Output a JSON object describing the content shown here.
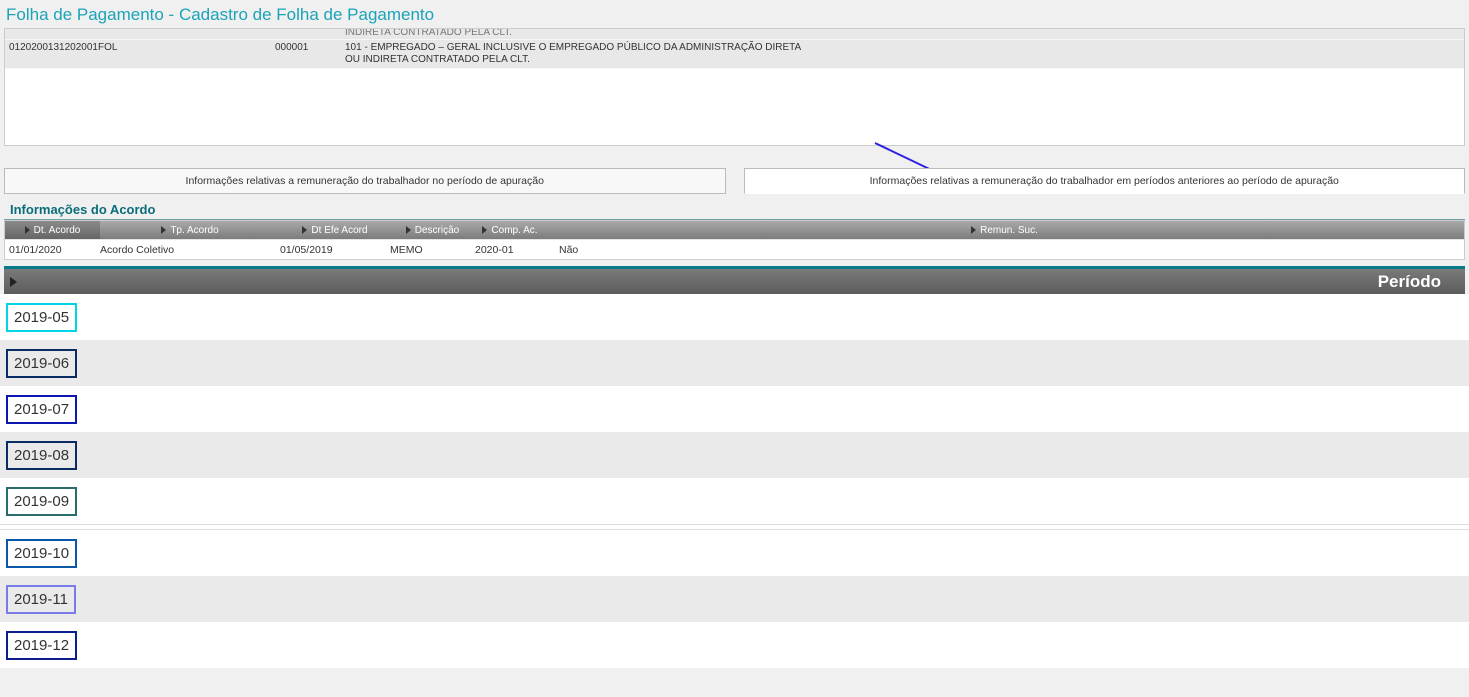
{
  "page_title": "Folha de Pagamento - Cadastro de Folha de Pagamento",
  "upper_grid": {
    "truncated_desc": "INDIRETA CONTRATADO PELA CLT.",
    "row": {
      "col1": "0120200131202001FOL",
      "col2": "000001",
      "col3": "101 - EMPREGADO – GERAL INCLUSIVE O EMPREGADO PÚBLICO DA ADMINISTRAÇÃO DIRETA OU INDIRETA CONTRATADO PELA CLT."
    }
  },
  "tabs": {
    "left": "Informações relativas a remuneração do trabalhador no período de apuração",
    "right": "Informações relativas a remuneração do trabalhador em períodos anteriores ao período de apuração"
  },
  "section_title": "Informações do Acordo",
  "acordo_headers": {
    "c1": "Dt. Acordo",
    "c2": "Tp. Acordo",
    "c3": "Dt Efe Acord",
    "c4": "Descrição",
    "c5": "Comp. Ac.",
    "c6": "Remun. Suc."
  },
  "acordo_row": {
    "c1": "01/01/2020",
    "c2": "Acordo Coletivo",
    "c3": "01/05/2019",
    "c4": "MEMO",
    "c5": "2020-01",
    "c6": "Não"
  },
  "periodo_label": "Período",
  "periodos": [
    {
      "value": "2019-05",
      "border": "#00d5e8"
    },
    {
      "value": "2019-06",
      "border": "#0b2d63"
    },
    {
      "value": "2019-07",
      "border": "#0a17b0"
    },
    {
      "value": "2019-08",
      "border": "#0b2d63"
    },
    {
      "value": "2019-09",
      "border": "#2a6b6b"
    },
    {
      "value": "2019-10",
      "border": "#0a58a8"
    },
    {
      "value": "2019-11",
      "border": "#7a7ae8"
    },
    {
      "value": "2019-12",
      "border": "#0b1d8f"
    }
  ]
}
